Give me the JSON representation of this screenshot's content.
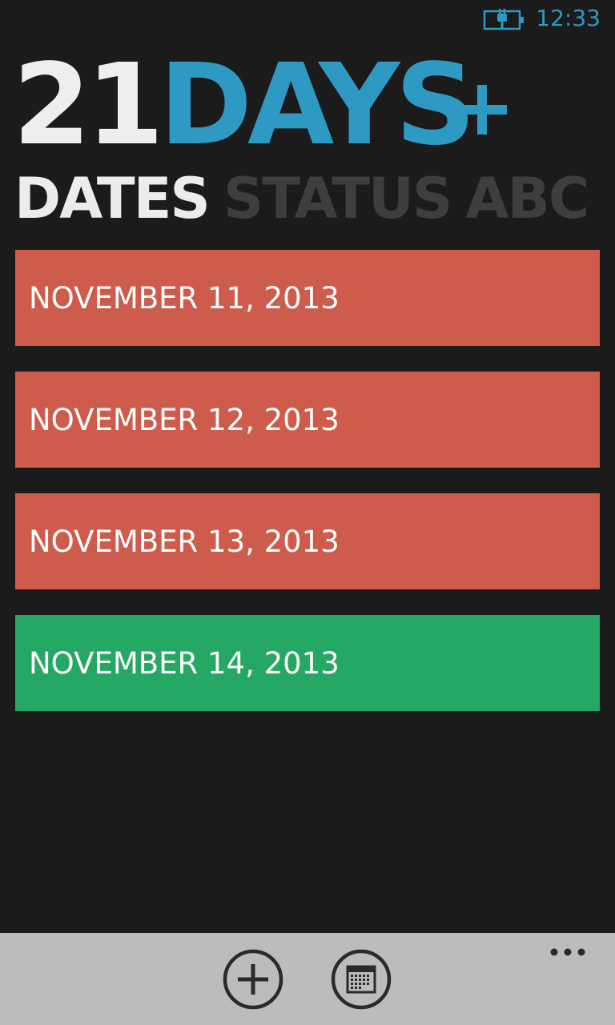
{
  "status_bar": {
    "time": "12:33",
    "battery_icon": "battery-charging-icon"
  },
  "header": {
    "title_number": "21",
    "title_word": "DAYS",
    "add_icon": "plus-icon"
  },
  "pivot": {
    "items": [
      {
        "label": "DATES",
        "active": true
      },
      {
        "label": "STATUS",
        "active": false
      },
      {
        "label": "ABC",
        "active": false
      }
    ]
  },
  "dates": [
    {
      "label": "NOVEMBER 11, 2013",
      "status": "red",
      "color": "#cd5c4c"
    },
    {
      "label": "NOVEMBER 12, 2013",
      "status": "red",
      "color": "#cd5c4c"
    },
    {
      "label": "NOVEMBER 13, 2013",
      "status": "red",
      "color": "#cd5c4c"
    },
    {
      "label": "NOVEMBER 14, 2013",
      "status": "green",
      "color": "#24a863"
    }
  ],
  "app_bar": {
    "buttons": [
      {
        "icon": "add-circle-icon"
      },
      {
        "icon": "calendar-icon"
      }
    ],
    "more_icon": "more-dots-icon"
  },
  "colors": {
    "background": "#1b1b1b",
    "accent": "#2e9ac4",
    "red": "#cd5c4c",
    "green": "#24a863",
    "app_bar": "#bcbcbc"
  }
}
